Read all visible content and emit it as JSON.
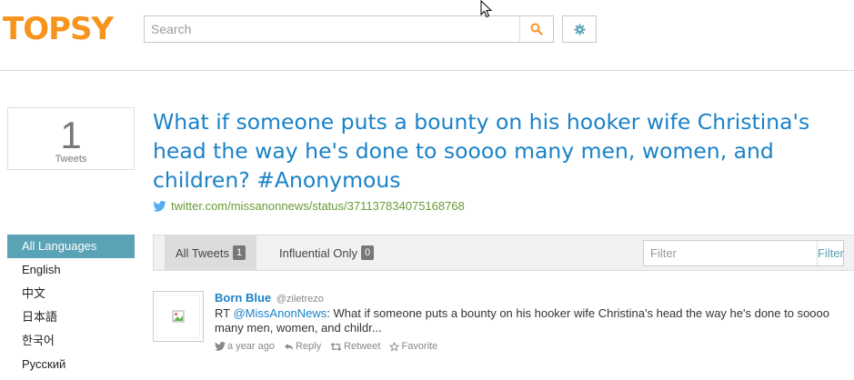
{
  "header": {
    "logo": "TOPSY",
    "search": {
      "placeholder": "Search",
      "value": ""
    },
    "icons": {
      "search": "search-icon",
      "settings": "gear-icon"
    },
    "colors": {
      "brand": "#f7941d",
      "accent": "#5aa2b5"
    }
  },
  "stats": {
    "count": "1",
    "label": "Tweets"
  },
  "title": "What if someone puts a bounty on his hooker wife Christina's head the way he's done to soooo many men, women, and children? #Anonymous",
  "source_link": "twitter.com/missanonnews/status/371137834075168768",
  "languages": [
    {
      "label": "All Languages",
      "active": true
    },
    {
      "label": "English"
    },
    {
      "label": "中文"
    },
    {
      "label": "日本語"
    },
    {
      "label": "한국어"
    },
    {
      "label": "Русский"
    }
  ],
  "tabs": [
    {
      "label": "All Tweets",
      "count": "1"
    },
    {
      "label": "Influential Only",
      "count": "0"
    }
  ],
  "filter": {
    "placeholder": "Filter",
    "button": "Filter"
  },
  "tweet": {
    "author": "Born Blue",
    "handle": "@ziletrezo",
    "prefix": "RT ",
    "mention": "@MissAnonNews",
    "text": ": What if someone puts a bounty on his hooker wife Christina's head the way he's done to soooo many men, women, and childr...",
    "time": "a year ago",
    "reply": "Reply",
    "retweet": "Retweet",
    "favorite": "Favorite"
  }
}
